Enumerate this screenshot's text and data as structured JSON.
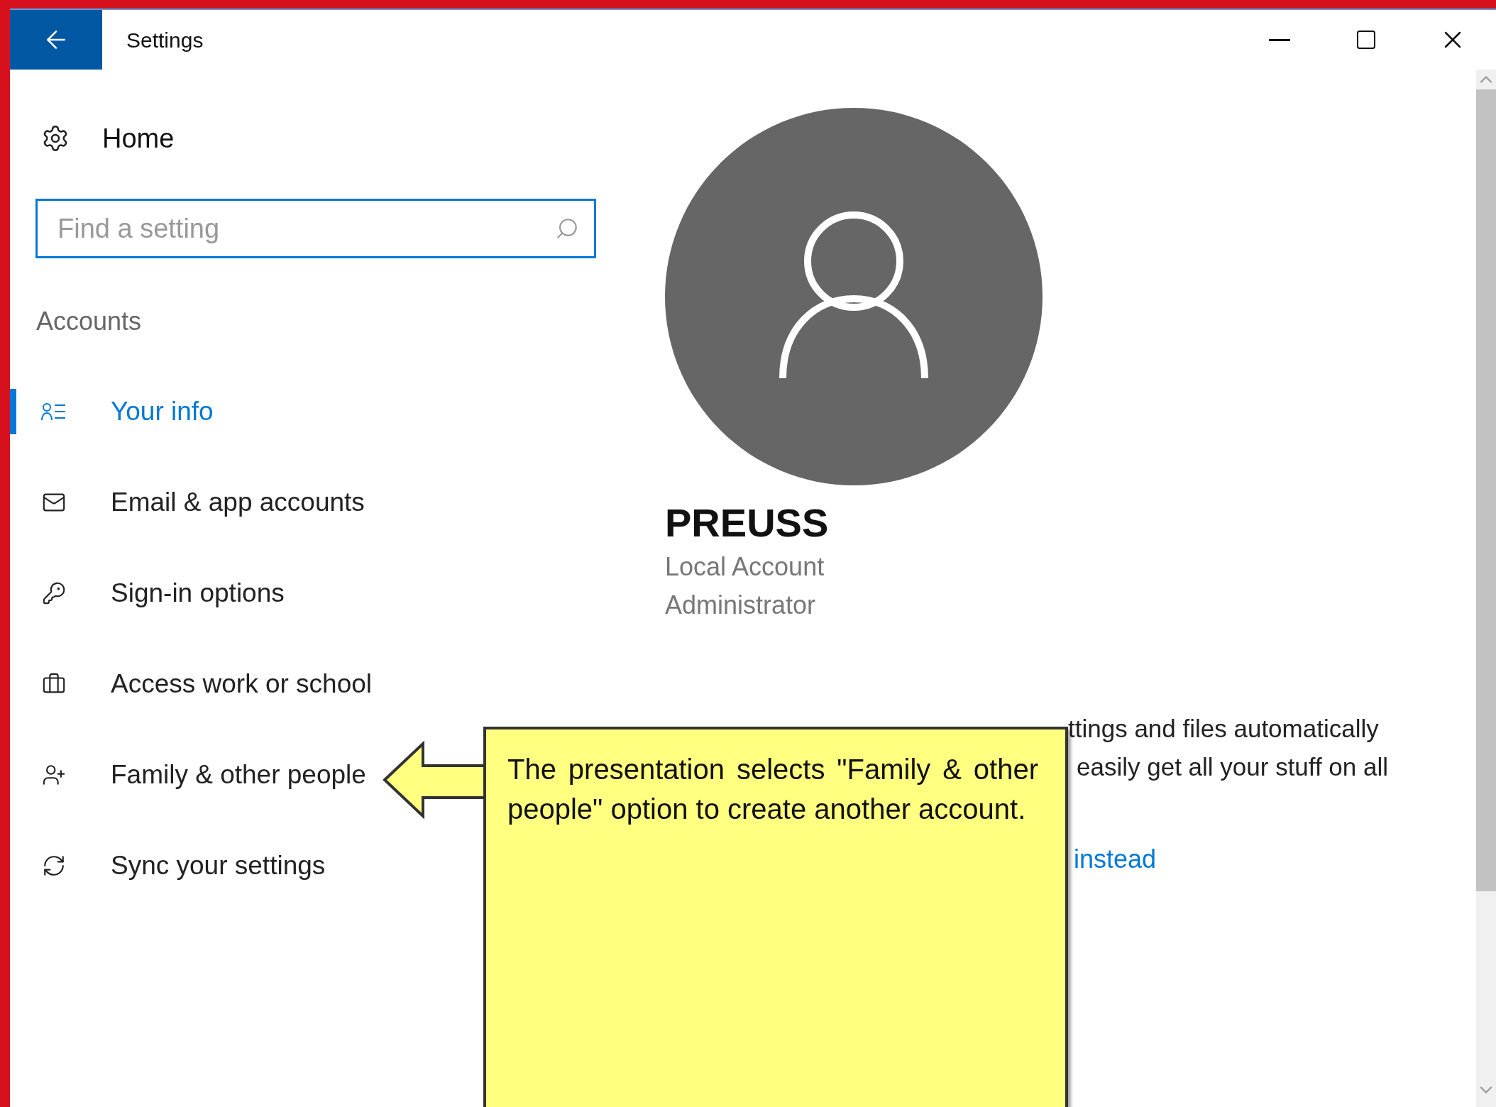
{
  "window": {
    "title": "Settings"
  },
  "sidebar": {
    "home": "Home",
    "search": {
      "placeholder": "Find a setting"
    },
    "section": "Accounts",
    "items": [
      {
        "label": "Your info",
        "selected": true
      },
      {
        "label": "Email & app accounts",
        "selected": false
      },
      {
        "label": "Sign-in options",
        "selected": false
      },
      {
        "label": "Access work or school",
        "selected": false
      },
      {
        "label": "Family & other people",
        "selected": false
      },
      {
        "label": "Sync your settings",
        "selected": false
      }
    ]
  },
  "profile": {
    "name": "PREUSS",
    "lines": [
      "Local Account",
      "Administrator"
    ]
  },
  "sync_notice": {
    "line_1": "ttings and files automatically",
    "line_2": "easily get all your stuff on all",
    "link": "instead"
  },
  "callout": {
    "text": "The presentation selects \"Family & other people\" option to create another account."
  }
}
